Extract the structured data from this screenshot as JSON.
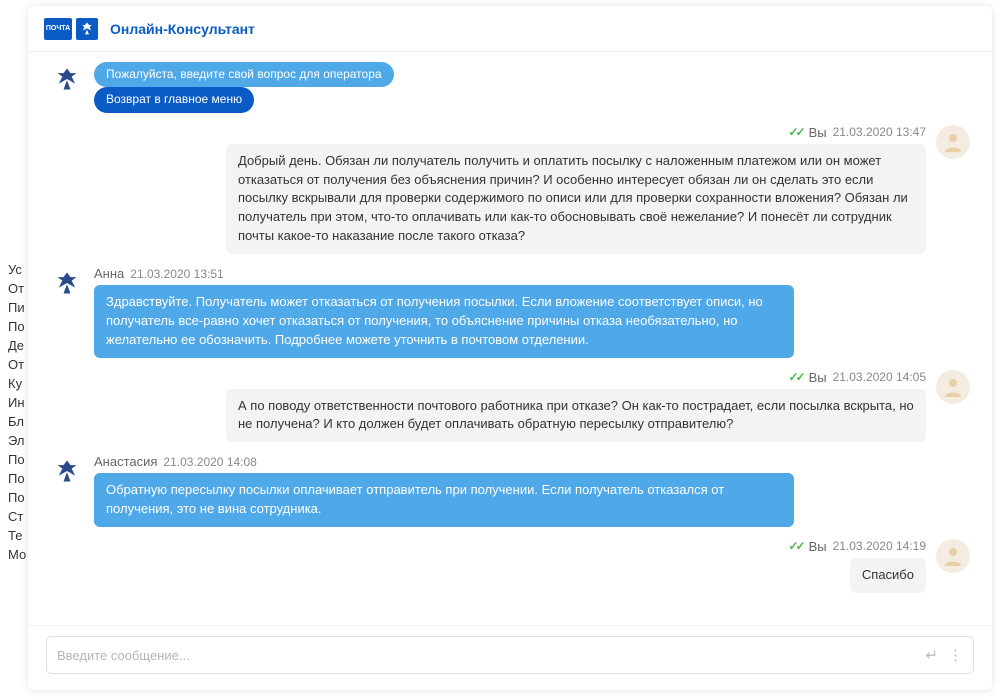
{
  "bg_nav": [
    "Ус",
    "От",
    "Пи",
    "По",
    "Де",
    "От",
    "Ку",
    "Ин",
    "Бл",
    "Эл",
    "По",
    "По",
    "По",
    "Ст",
    "Те",
    "Мо"
  ],
  "header": {
    "logo_text": "ПОЧТА",
    "title": "Онлайн-Консультант"
  },
  "messages": [
    {
      "side": "incoming",
      "avatar": "eagle",
      "meta": null,
      "bubbles": [
        {
          "style": "blue pill",
          "text": "Пожалуйста, введите свой вопрос для оператора"
        },
        {
          "style": "blue-dark pill",
          "text": "Возврат в главное меню"
        }
      ]
    },
    {
      "side": "outgoing",
      "avatar": "user",
      "meta": {
        "checks": true,
        "name": "Вы",
        "time": "21.03.2020 13:47"
      },
      "bubbles": [
        {
          "style": "gray",
          "text": "Добрый день. Обязан ли получатель получить и оплатить посылку с наложенным платежом или он может отказаться от получения без объяснения причин? И особенно интересует обязан ли он сделать это если посылку вскрывали для проверки содержимого по описи или для проверки сохранности вложения? Обязан ли получатель при этом, что-то оплачивать или как-то обосновывать своё нежелание? И понесёт ли сотрудник почты какое-то наказание после такого отказа?"
        }
      ]
    },
    {
      "side": "incoming",
      "avatar": "eagle",
      "meta": {
        "name": "Анна",
        "time": "21.03.2020 13:51"
      },
      "bubbles": [
        {
          "style": "blue",
          "text": "Здравствуйте. Получатель может отказаться от получения посылки. Если вложение соответствует описи, но получатель все-равно хочет отказаться от получения, то объяснение причины отказа необязательно, но желательно ее обозначить. Подробнее можете уточнить в почтовом отделении."
        }
      ]
    },
    {
      "side": "outgoing",
      "avatar": "user",
      "meta": {
        "checks": true,
        "name": "Вы",
        "time": "21.03.2020 14:05"
      },
      "bubbles": [
        {
          "style": "gray",
          "text": "А по поводу ответственности почтового работника при отказе? Он как-то пострадает, если посылка вскрыта, но не получена? И кто должен будет оплачивать обратную пересылку отправителю?"
        }
      ]
    },
    {
      "side": "incoming",
      "avatar": "eagle",
      "meta": {
        "name": "Анастасия",
        "time": "21.03.2020 14:08"
      },
      "bubbles": [
        {
          "style": "blue",
          "text": "Обратную пересылку посылки оплачивает отправитель при получении. Если получатель отказался от получения, это не вина сотрудника."
        }
      ]
    },
    {
      "side": "outgoing",
      "avatar": "user",
      "meta": {
        "checks": true,
        "name": "Вы",
        "time": "21.03.2020 14:19"
      },
      "bubbles": [
        {
          "style": "gray",
          "text": "Спасибо"
        }
      ]
    }
  ],
  "input": {
    "placeholder": "Введите сообщение..."
  }
}
